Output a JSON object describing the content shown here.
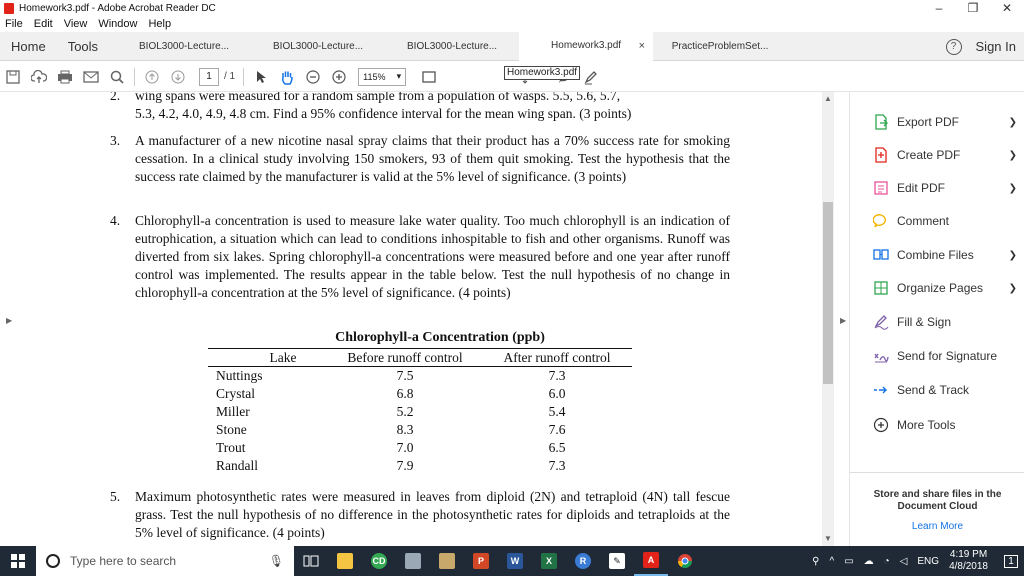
{
  "window": {
    "title": "Homework3.pdf - Adobe Acrobat Reader DC",
    "minimize": "–",
    "restore": "❐",
    "close": "✕"
  },
  "menu": [
    "File",
    "Edit",
    "View",
    "Window",
    "Help"
  ],
  "tabs": {
    "home": "Home",
    "tools": "Tools",
    "documents": [
      {
        "label": "BIOL3000-Lecture..."
      },
      {
        "label": "BIOL3000-Lecture..."
      },
      {
        "label": "BIOL3000-Lecture..."
      },
      {
        "label": "Homework3.pdf",
        "close": "×"
      },
      {
        "label": "PracticeProblemSet..."
      }
    ],
    "help": "?",
    "sign_in": "Sign In"
  },
  "toolbar": {
    "page_current": "1",
    "page_total": "/ 1",
    "zoom": "115%",
    "zoom_arrow": "▾",
    "tooltip": "Homework3.pdf"
  },
  "document": {
    "item2_partial_top": "wing spans were measured for a random sample from a population of wasps. 5.5, 5.6, 5.7,",
    "item2_line": "5.3, 4.2, 4.0, 4.9, 4.8 cm. Find a 95% confidence interval for the mean wing span. (3 points)",
    "item2_num": "2.",
    "item3_num": "3.",
    "item3_text": "A manufacturer of a new nicotine nasal spray claims that their product has a 70% success rate for smoking cessation. In a clinical study involving 150 smokers, 93 of them quit smoking. Test the hypothesis that the success rate claimed by the manufacturer is valid at the 5% level of significance. (3 points)",
    "item4_num": "4.",
    "item4_text": "Chlorophyll-a concentration is used to measure lake water quality. Too much chlorophyll is an indication of eutrophication, a situation which can lead to conditions inhospitable to fish and other organisms. Runoff was diverted from six lakes. Spring chlorophyll-a concentrations were measured before and one year after runoff control was implemented. The results appear in the table below. Test the null hypothesis of no change in chlorophyll-a concentration at the 5% level of significance. (4 points)",
    "item5_num": "5.",
    "item5_text": "Maximum photosynthetic rates were measured in leaves from diploid (2N) and tetraploid (4N) tall fescue grass. Test the null hypothesis of no difference in the photosynthetic rates for diploids and tetraploids at the 5% level of significance. (4 points)"
  },
  "table": {
    "title": "Chlorophyll-a Concentration (ppb)",
    "headers": [
      "Lake",
      "Before runoff control",
      "After runoff control"
    ],
    "rows": [
      [
        "Nuttings",
        "7.5",
        "7.3"
      ],
      [
        "Crystal",
        "6.8",
        "6.0"
      ],
      [
        "Miller",
        "5.2",
        "5.4"
      ],
      [
        "Stone",
        "8.3",
        "7.6"
      ],
      [
        "Trout",
        "7.0",
        "6.5"
      ],
      [
        "Randall",
        "7.9",
        "7.3"
      ]
    ]
  },
  "right_pane": {
    "items": [
      {
        "label": "Export PDF",
        "icon": "export-pdf-icon",
        "color": "#2ea44f"
      },
      {
        "label": "Create PDF",
        "icon": "create-pdf-icon",
        "color": "#e2231a"
      },
      {
        "label": "Edit PDF",
        "icon": "edit-pdf-icon",
        "color": "#e9529a"
      },
      {
        "label": "Comment",
        "icon": "comment-icon",
        "color": "#f4b400"
      },
      {
        "label": "Combine Files",
        "icon": "combine-files-icon",
        "color": "#1473e6"
      },
      {
        "label": "Organize Pages",
        "icon": "organize-pages-icon",
        "color": "#2ea44f"
      },
      {
        "label": "Fill & Sign",
        "icon": "fill-sign-icon",
        "color": "#7b5ea7"
      },
      {
        "label": "Send for Signature",
        "icon": "send-signature-icon",
        "color": "#7b5ea7"
      },
      {
        "label": "Send & Track",
        "icon": "send-track-icon",
        "color": "#1473e6"
      },
      {
        "label": "More Tools",
        "icon": "more-tools-icon",
        "color": "#333333"
      }
    ],
    "store_text": "Store and share files in the Document Cloud",
    "learn_more": "Learn More"
  },
  "taskbar": {
    "search_placeholder": "Type here to search",
    "language": "ENG",
    "time": "4:19 PM",
    "date": "4/8/2018",
    "notifications": "1"
  }
}
